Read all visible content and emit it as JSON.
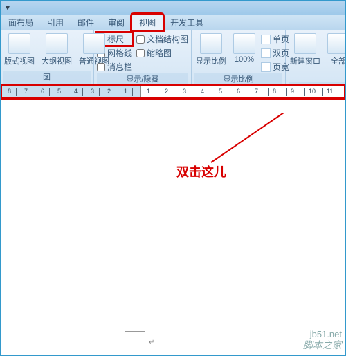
{
  "qat": {
    "dropdown_glyph": "▾"
  },
  "tabs": {
    "items": [
      {
        "label": "面布局"
      },
      {
        "label": "引用"
      },
      {
        "label": "邮件"
      },
      {
        "label": "审阅"
      },
      {
        "label": "视图"
      },
      {
        "label": "开发工具"
      }
    ],
    "active_index": 4
  },
  "ribbon": {
    "views_group": {
      "title": "图",
      "buttons": [
        {
          "label": "版式视图"
        },
        {
          "label": "大纲视图"
        },
        {
          "label": "普通视图"
        }
      ]
    },
    "show_hide_group": {
      "title": "显示/隐藏",
      "col1": [
        {
          "label": "标尺",
          "checked": true
        },
        {
          "label": "网格线",
          "checked": false
        },
        {
          "label": "消息栏",
          "checked": false
        }
      ],
      "col2": [
        {
          "label": "文档结构图",
          "checked": false
        },
        {
          "label": "缩略图",
          "checked": false
        }
      ]
    },
    "zoom_group": {
      "title": "显示比例",
      "buttons": [
        {
          "label": "显示比例"
        },
        {
          "label": "100%"
        }
      ],
      "col": [
        {
          "label": "单页"
        },
        {
          "label": "双页"
        },
        {
          "label": "页宽"
        }
      ]
    },
    "window_group": {
      "buttons": [
        {
          "label": "新建窗口"
        },
        {
          "label": "全部"
        }
      ]
    }
  },
  "ruler": {
    "left_numbers": [
      "8",
      "7",
      "6",
      "5",
      "4",
      "3",
      "2",
      "1"
    ],
    "right_numbers": [
      "1",
      "2",
      "3",
      "4",
      "5",
      "6",
      "7",
      "8",
      "9",
      "10",
      "11"
    ]
  },
  "annotation": {
    "text": "双击这儿"
  },
  "paragraph_mark": "↵",
  "watermark1": "脚本之家",
  "watermark2": "jb51.net"
}
